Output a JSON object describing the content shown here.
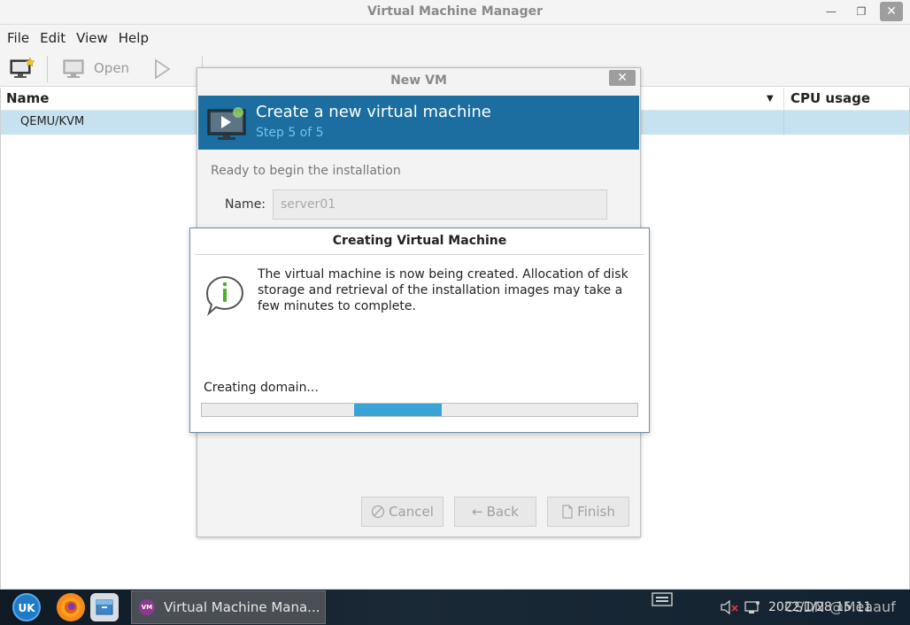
{
  "window": {
    "title": "Virtual Machine Manager",
    "min_glyph": "—",
    "max_glyph": "❐",
    "close_glyph": "✕"
  },
  "menu": {
    "file": "File",
    "edit": "Edit",
    "view": "View",
    "help": "Help"
  },
  "toolbar": {
    "open_label": "Open"
  },
  "list": {
    "col_name": "Name",
    "col_cpu": "CPU usage",
    "rows": [
      {
        "label": "QEMU/KVM"
      }
    ]
  },
  "new_vm": {
    "title": "New VM",
    "close_glyph": "✕",
    "heading": "Create a new virtual machine",
    "step": "Step 5 of 5",
    "ready_text": "Ready to begin the installation",
    "name_label": "Name:",
    "name_value": "server01",
    "cancel_label": "Cancel",
    "back_label": "Back",
    "finish_label": "Finish",
    "back_glyph": "←"
  },
  "creating": {
    "title": "Creating Virtual Machine",
    "message": "The virtual machine is now being created. Allocation of disk storage and retrieval of the installation images may take a few minutes to complete.",
    "status": "Creating domain...",
    "progress_indicator": {
      "type": "indeterminate",
      "start_fraction": 0.35,
      "width_fraction": 0.2
    },
    "progress_color": "#3aa3d6"
  },
  "taskbar": {
    "task_label": "Virtual Machine Mana...",
    "task_icon_text": "VM",
    "clock": "2022/1/28 15:11",
    "watermark": "CSDN @Meaauf"
  },
  "colors": {
    "banner": "#1b6e9f",
    "selected_row": "#c6e2f0",
    "step_text": "#6fc3ee"
  },
  "icons": {
    "new_vm": "monitor-star-icon",
    "open": "monitor-icon",
    "run": "play-icon",
    "info": "info-bubble-icon",
    "start_menu": "uk-logo-icon",
    "browser": "firefox-icon",
    "files": "file-manager-icon",
    "volume": "volume-muted-icon",
    "network": "network-icon"
  }
}
